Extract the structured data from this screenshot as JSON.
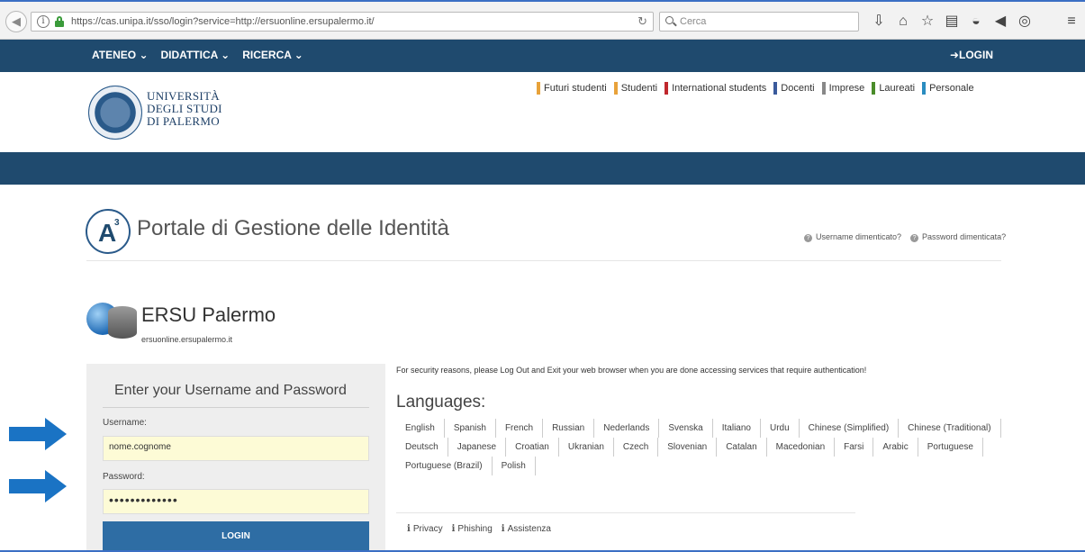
{
  "browser": {
    "url": "https://cas.unipa.it/sso/login?service=http://ersuonline.ersupalermo.it/",
    "search_placeholder": "Cerca"
  },
  "topnav": {
    "menu": [
      "ATENEO ⌄",
      "DIDATTICA ⌄",
      "RICERCA ⌄"
    ],
    "login": "LOGIN"
  },
  "header": {
    "logo_lines": [
      "UNIVERSITÀ",
      "DEGLI STUDI",
      "DI PALERMO"
    ],
    "audiences": [
      {
        "label": "Futuri studenti",
        "color": "#e8a23a"
      },
      {
        "label": "Studenti",
        "color": "#e8a23a"
      },
      {
        "label": "International students",
        "color": "#c0272d"
      },
      {
        "label": "Docenti",
        "color": "#3a5a9c"
      },
      {
        "label": "Imprese",
        "color": "#888888"
      },
      {
        "label": "Laureati",
        "color": "#4a8c2a"
      },
      {
        "label": "Personale",
        "color": "#2a8cc0"
      }
    ]
  },
  "portal": {
    "title": "Portale di Gestione delle Identità",
    "username_forgot": "Username dimenticato?",
    "password_forgot": "Password dimenticata?"
  },
  "service": {
    "name": "ERSU Palermo",
    "url": "ersuonline.ersupalermo.it"
  },
  "login_form": {
    "title": "Enter your Username and Password",
    "username_label": "Username:",
    "username_value": "nome.cognome",
    "password_label": "Password:",
    "password_value": "•••••••••••••",
    "submit": "LOGIN"
  },
  "security_notice": "For security reasons, please Log Out and Exit your web browser when you are done accessing services that require authentication!",
  "languages": {
    "title": "Languages:",
    "items": [
      "English",
      "Spanish",
      "French",
      "Russian",
      "Nederlands",
      "Svenska",
      "Italiano",
      "Urdu",
      "Chinese (Simplified)",
      "Chinese (Traditional)",
      "Deutsch",
      "Japanese",
      "Croatian",
      "Ukranian",
      "Czech",
      "Slovenian",
      "Catalan",
      "Macedonian",
      "Farsi",
      "Arabic",
      "Portuguese",
      "Portuguese (Brazil)",
      "Polish"
    ]
  },
  "footer": {
    "links": [
      "Privacy",
      "Phishing",
      "Assistenza"
    ]
  },
  "colors": {
    "nav_bg": "#1f4a6e",
    "button_bg": "#2e6da4",
    "arrow": "#1a73c4",
    "input_bg": "#fdfbd6"
  }
}
